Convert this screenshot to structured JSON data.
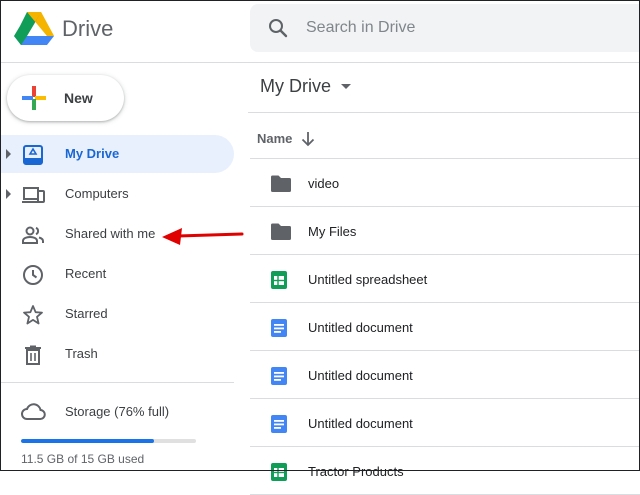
{
  "app": {
    "name": "Drive"
  },
  "search": {
    "placeholder": "Search in Drive"
  },
  "sidebar": {
    "new_label": "New",
    "items": [
      {
        "label": "My Drive",
        "icon": "my-drive-icon",
        "active": true,
        "expandable": true
      },
      {
        "label": "Computers",
        "icon": "computers-icon",
        "active": false,
        "expandable": true
      },
      {
        "label": "Shared with me",
        "icon": "shared-people-icon",
        "active": false,
        "expandable": false
      },
      {
        "label": "Recent",
        "icon": "clock-icon",
        "active": false,
        "expandable": false
      },
      {
        "label": "Starred",
        "icon": "star-icon",
        "active": false,
        "expandable": false
      },
      {
        "label": "Trash",
        "icon": "trash-icon",
        "active": false,
        "expandable": false
      }
    ],
    "storage": {
      "label": "Storage (76% full)",
      "used_text": "11.5 GB of 15 GB used",
      "fraction": 0.76
    }
  },
  "annotation": {
    "type": "red-arrow",
    "points_to": "Shared with me",
    "color": "#e00000"
  },
  "main": {
    "title": "My Drive",
    "column_header": "Name",
    "sort": "descending",
    "files": [
      {
        "name": "video",
        "type": "folder"
      },
      {
        "name": "My Files",
        "type": "folder"
      },
      {
        "name": "Untitled spreadsheet",
        "type": "spreadsheet"
      },
      {
        "name": "Untitled document",
        "type": "document"
      },
      {
        "name": "Untitled document",
        "type": "document"
      },
      {
        "name": "Untitled document",
        "type": "document"
      },
      {
        "name": "Tractor Products",
        "type": "spreadsheet"
      }
    ]
  },
  "colors": {
    "accent": "#1a73e8",
    "active_bg": "#e8f0fe",
    "active_text": "#1967d2",
    "folder": "#5f6368",
    "sheets": "#0f9d58",
    "docs": "#4285f4",
    "arrow": "#e00000"
  }
}
